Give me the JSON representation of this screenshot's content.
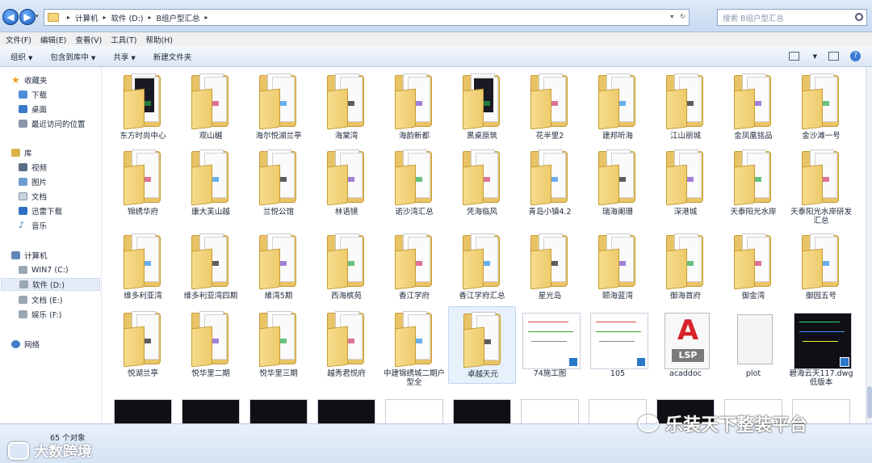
{
  "address": {
    "crumbs": [
      "计算机",
      "软件 (D:)",
      "B组户型汇总"
    ],
    "search_placeholder": "搜索 B组户型汇总"
  },
  "menu": [
    "文件(F)",
    "编辑(E)",
    "查看(V)",
    "工具(T)",
    "帮助(H)"
  ],
  "toolbar": {
    "organize": "组织",
    "include_library": "包含到库中",
    "share": "共享",
    "new_folder": "新建文件夹"
  },
  "sidebar": {
    "favorites": "收藏夹",
    "downloads": "下载",
    "desktop": "桌面",
    "recent": "最近访问的位置",
    "libraries": "库",
    "videos": "视频",
    "pictures": "图片",
    "documents": "文档",
    "thunder": "迅雷下载",
    "music": "音乐",
    "computer": "计算机",
    "drive_c": "WIN7 (C:)",
    "drive_d": "软件 (D:)",
    "drive_e": "文档 (E:)",
    "drive_f": "娱乐 (F:)",
    "network": "网络"
  },
  "items": [
    "东方时尚中心",
    "观山樾",
    "海尔悦湖兰亭",
    "海棠湾",
    "海韵新都",
    "黑桌原筑",
    "花半里2",
    "建邦听海",
    "江山丽城",
    "金凤凰铭品",
    "金沙滩一号",
    "锦绣华府",
    "康大芙山越",
    "兰悦公馆",
    "林语镜",
    "诺沙湾汇总",
    "凭海临风",
    "青岛小镇4.2",
    "瑞海阑珊",
    "深港城",
    "天泰阳光水岸",
    "天泰阳光水岸研发汇总",
    "维多利亚湾",
    "维多利亚湾四期",
    "維湾5期",
    "西海槟苑",
    "香江学府",
    "香江学府汇总",
    "星光岛",
    "颐海蓝湾",
    "御海首府",
    "御金湾",
    "御园五号",
    "悦湖兰亭",
    "悦华里二期",
    "悦华里三期",
    "越秀君悦府",
    "中建锦绣城二期户型全",
    "卓越天元",
    "74施工图",
    "105",
    "acaddoc",
    "plot",
    "碧海云天117.dwg低版本"
  ],
  "status": {
    "count": "65 个对象"
  },
  "watermark": {
    "left": "大数跨境",
    "right": "乐装天下整装平台"
  }
}
